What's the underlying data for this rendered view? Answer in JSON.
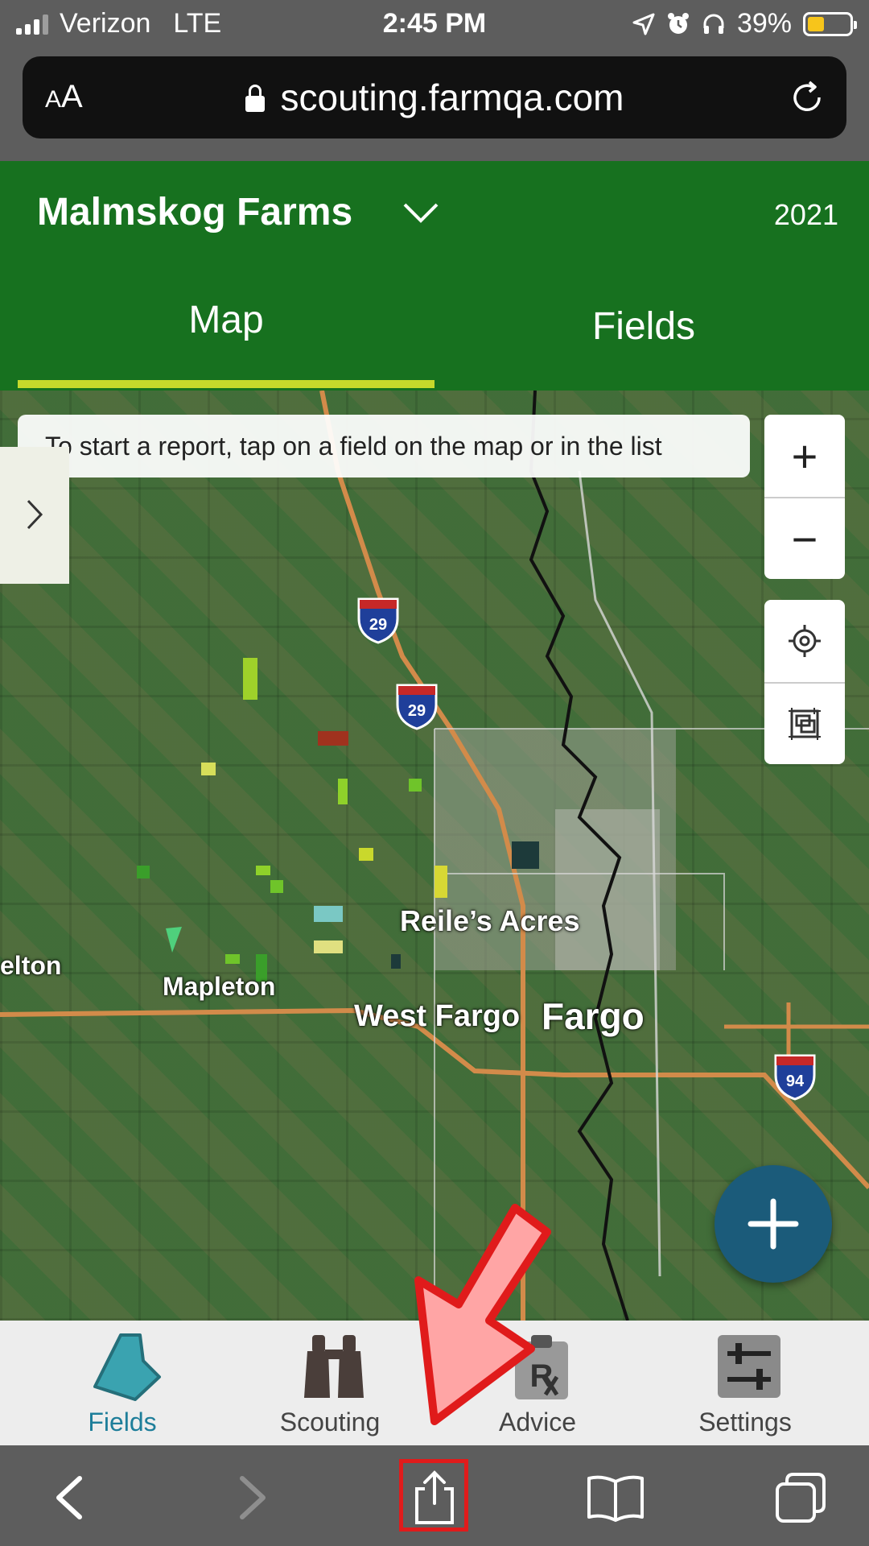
{
  "status_bar": {
    "carrier": "Verizon",
    "network": "LTE",
    "time": "2:45 PM",
    "battery_percent": "39%",
    "battery_level": 0.39
  },
  "browser": {
    "text_size_label": "AA",
    "url": "scouting.farmqa.com"
  },
  "header": {
    "farm_name": "Malmskog Farms",
    "year": "2021"
  },
  "tabs": [
    {
      "label": "Map",
      "active": true
    },
    {
      "label": "Fields",
      "active": false
    }
  ],
  "map": {
    "hint": "To start a report, tap on a field on the map or in the list",
    "zoom_in": "+",
    "zoom_out": "−",
    "labels": {
      "reiles_acres": "Reile’s Acres",
      "mapleton": "Mapleton",
      "elton": "elton",
      "west_fargo": "West Fargo",
      "fargo": "Fargo"
    },
    "shields": {
      "i29a": "29",
      "i29b": "29",
      "i94": "94"
    },
    "fab": "+"
  },
  "nav": [
    {
      "label": "Fields",
      "icon": "field-polygon-icon",
      "active": true
    },
    {
      "label": "Scouting",
      "icon": "binoculars-icon",
      "active": false
    },
    {
      "label": "Advice",
      "icon": "clipboard-rx-icon",
      "active": false
    },
    {
      "label": "Settings",
      "icon": "sliders-icon",
      "active": false
    }
  ],
  "colors": {
    "header_green": "#17711f",
    "tab_underline": "#c6d92b",
    "fab_blue": "#1b5b7a",
    "active_nav": "#1e7e9a",
    "highlight_red": "#e01b1b"
  }
}
